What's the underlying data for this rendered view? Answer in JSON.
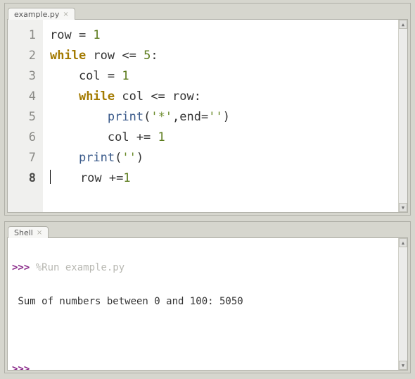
{
  "editor": {
    "tab_label": "example.py",
    "current_line": 8,
    "lines": [
      {
        "n": 1,
        "tokens": [
          [
            "",
            "row = "
          ],
          [
            "num",
            "1"
          ]
        ]
      },
      {
        "n": 2,
        "tokens": [
          [
            "kw",
            "while"
          ],
          [
            "",
            " row <= "
          ],
          [
            "num",
            "5"
          ],
          [
            "",
            ":"
          ]
        ]
      },
      {
        "n": 3,
        "tokens": [
          [
            "",
            "    col = "
          ],
          [
            "num",
            "1"
          ]
        ]
      },
      {
        "n": 4,
        "tokens": [
          [
            "",
            "    "
          ],
          [
            "kw",
            "while"
          ],
          [
            "",
            " col <= row:"
          ]
        ]
      },
      {
        "n": 5,
        "tokens": [
          [
            "",
            "        "
          ],
          [
            "fn",
            "print"
          ],
          [
            "",
            "("
          ],
          [
            "str",
            "'*'"
          ],
          [
            "",
            ",end="
          ],
          [
            "str",
            "''"
          ],
          [
            "",
            ")"
          ]
        ]
      },
      {
        "n": 6,
        "tokens": [
          [
            "",
            "        col += "
          ],
          [
            "num",
            "1"
          ]
        ]
      },
      {
        "n": 7,
        "tokens": [
          [
            "",
            "    "
          ],
          [
            "fn",
            "print"
          ],
          [
            "",
            "("
          ],
          [
            "str",
            "''"
          ],
          [
            "",
            ")"
          ]
        ]
      },
      {
        "n": 8,
        "tokens": [
          [
            "",
            "    row +="
          ],
          [
            "num",
            "1"
          ]
        ]
      }
    ]
  },
  "shell": {
    "tab_label": "Shell",
    "prompt": ">>>",
    "run_cmd": "%Run example.py",
    "output": " Sum of numbers between 0 and 100: 5050"
  }
}
